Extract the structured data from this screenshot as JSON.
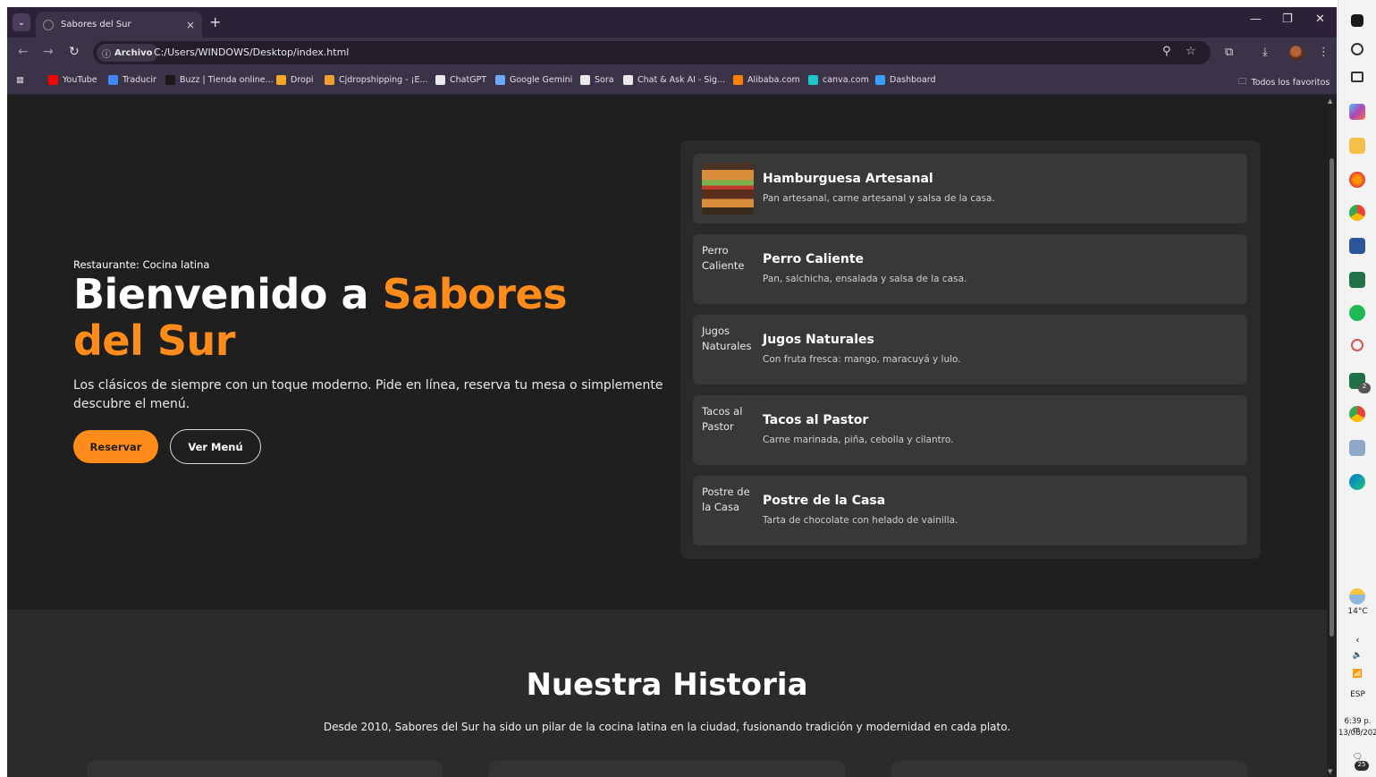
{
  "browser": {
    "tab_title": "Sabores del Sur",
    "tab_close": "×",
    "new_tab": "+",
    "url_chip": "Archivo",
    "url": "C:/Users/WINDOWS/Desktop/index.html",
    "bookmarks": [
      {
        "label": "YouTube",
        "color": "#ff0000"
      },
      {
        "label": "Traducir",
        "color": "#4285f4"
      },
      {
        "label": "Buzz | Tienda online...",
        "color": "#1a1a1a"
      },
      {
        "label": "Dropi",
        "color": "#f5a623"
      },
      {
        "label": "Cjdropshipping - ¡E...",
        "color": "#f0a030"
      },
      {
        "label": "ChatGPT",
        "color": "#e8e8e8"
      },
      {
        "label": "Google Gemini",
        "color": "#6fa8ff"
      },
      {
        "label": "Sora",
        "color": "#e8e8e8"
      },
      {
        "label": "Chat & Ask AI - Sig...",
        "color": "#e8e8e8"
      },
      {
        "label": "Alibaba.com",
        "color": "#ff8000"
      },
      {
        "label": "canva.com",
        "color": "#20c4cb"
      },
      {
        "label": "Dashboard",
        "color": "#3aa0ff"
      }
    ],
    "all_favorites": "Todos los favoritos"
  },
  "hero": {
    "tag": "Restaurante: Cocina latina",
    "title_prefix": "Bienvenido a ",
    "title_accent": "Sabores del Sur",
    "description": "Los clásicos de siempre con un toque moderno. Pide en línea, reserva tu mesa o simplemente descubre el menú.",
    "primary_button": "Reservar",
    "secondary_button": "Ver Menú"
  },
  "menu": [
    {
      "name": "Hamburguesa Artesanal",
      "desc": "Pan artesanal, carne artesanal y salsa de la casa.",
      "alt": "Hamburguesa Artesanal"
    },
    {
      "name": "Perro Caliente",
      "desc": "Pan, salchicha, ensalada y salsa de la casa.",
      "alt": "Perro Caliente"
    },
    {
      "name": "Jugos Naturales",
      "desc": "Con fruta fresca: mango, maracuyá y lulo.",
      "alt": "Jugos Naturales"
    },
    {
      "name": "Tacos al Pastor",
      "desc": "Carne marinada, piña, cebolla y cilantro.",
      "alt": "Tacos al Pastor"
    },
    {
      "name": "Postre de la Casa",
      "desc": "Tarta de chocolate con helado de vainilla.",
      "alt": "Postre de la Casa"
    }
  ],
  "history": {
    "title": "Nuestra Historia",
    "text": "Desde 2010, Sabores del Sur ha sido un pilar de la cocina latina en la ciudad, fusionando tradición y modernidad en cada plato."
  },
  "taskbar": {
    "temperature": "14°C",
    "language": "ESP",
    "time": "6:39 p. m.",
    "date": "13/08/202",
    "notif_count": "25",
    "badge": "2"
  },
  "colors": {
    "accent": "#ff8c1a",
    "page_bg": "#1f1f1f",
    "card_bg": "#383838"
  }
}
